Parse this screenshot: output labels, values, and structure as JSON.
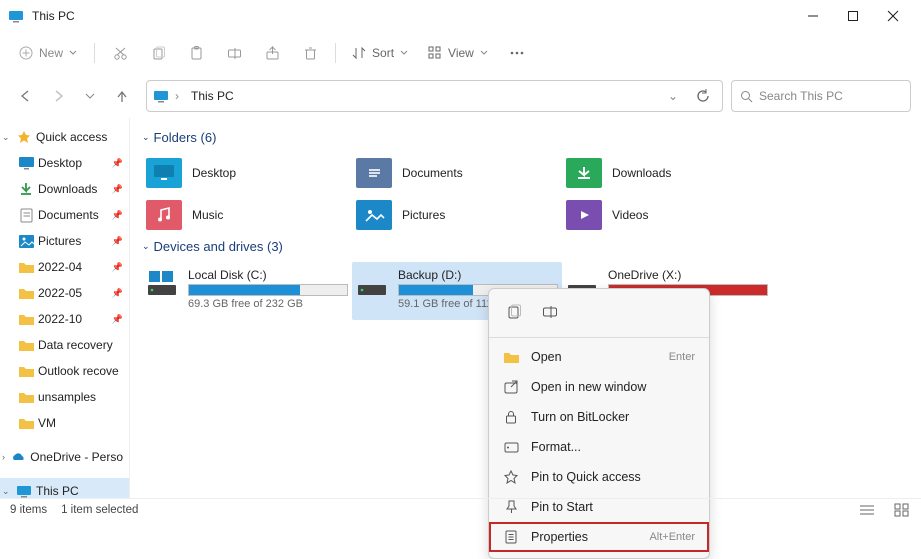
{
  "window": {
    "title": "This PC"
  },
  "toolbar": {
    "new": "New",
    "sort": "Sort",
    "view": "View"
  },
  "address": {
    "crumb": "This PC"
  },
  "search": {
    "placeholder": "Search This PC"
  },
  "sidebar": {
    "quick_access": "Quick access",
    "desktop": "Desktop",
    "downloads": "Downloads",
    "documents": "Documents",
    "pictures": "Pictures",
    "f_2022_04": "2022-04",
    "f_2022_05": "2022-05",
    "f_2022_10": "2022-10",
    "data_recovery": "Data recovery",
    "outlook_recovery": "Outlook recove",
    "unsamples": "unsamples",
    "vm": "VM",
    "onedrive": "OneDrive - Perso",
    "this_pc": "This PC"
  },
  "sections": {
    "folders": "Folders (6)",
    "drives": "Devices and drives (3)"
  },
  "folders": {
    "desktop": "Desktop",
    "documents": "Documents",
    "downloads": "Downloads",
    "music": "Music",
    "pictures": "Pictures",
    "videos": "Videos"
  },
  "drives": {
    "c": {
      "name": "Local Disk (C:)",
      "free": "69.3 GB free of 232 GB",
      "fill_pct": 70
    },
    "d": {
      "name": "Backup (D:)",
      "free": "59.1 GB free of 111 GB",
      "fill_pct": 47
    },
    "x": {
      "name": "OneDrive (X:)",
      "free": "",
      "fill_pct": 100
    }
  },
  "context_menu": {
    "open": "Open",
    "open_accel": "Enter",
    "open_new": "Open in new window",
    "bitlocker": "Turn on BitLocker",
    "format": "Format...",
    "pin_quick": "Pin to Quick access",
    "pin_start": "Pin to Start",
    "properties": "Properties",
    "properties_accel": "Alt+Enter"
  },
  "status": {
    "items": "9 items",
    "selected": "1 item selected"
  }
}
